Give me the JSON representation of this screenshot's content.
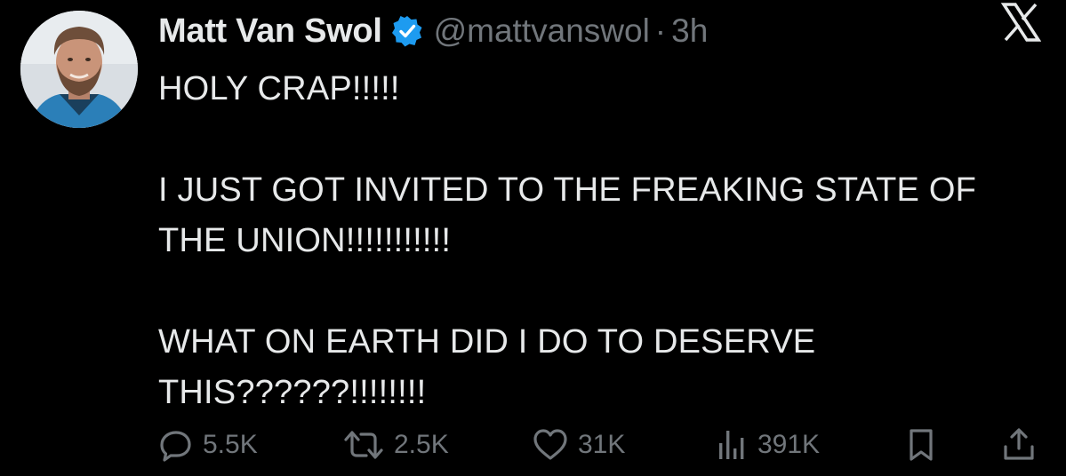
{
  "tweet": {
    "author": {
      "name": "Matt Van Swol",
      "handle": "@mattvanswol",
      "verified": true,
      "avatar_icon": "profile-photo"
    },
    "separator": "·",
    "time": "3h",
    "body": [
      "HOLY CRAP!!!!!",
      "I JUST GOT INVITED TO THE FREAKING STATE OF THE UNION!!!!!!!!!!!",
      "WHAT ON EARTH DID I DO TO DESERVE THIS??????!!!!!!!!"
    ],
    "actions": {
      "reply": {
        "icon": "reply-icon",
        "count": "5.5K"
      },
      "retweet": {
        "icon": "retweet-icon",
        "count": "2.5K"
      },
      "like": {
        "icon": "heart-icon",
        "count": "31K"
      },
      "views": {
        "icon": "views-icon",
        "count": "391K"
      },
      "bookmark": {
        "icon": "bookmark-icon"
      },
      "share": {
        "icon": "share-icon"
      }
    }
  },
  "platform_logo": "x-logo",
  "colors": {
    "background": "#000000",
    "text": "#e7e9ea",
    "muted": "#71767b",
    "verified": "#1d9bf0"
  }
}
